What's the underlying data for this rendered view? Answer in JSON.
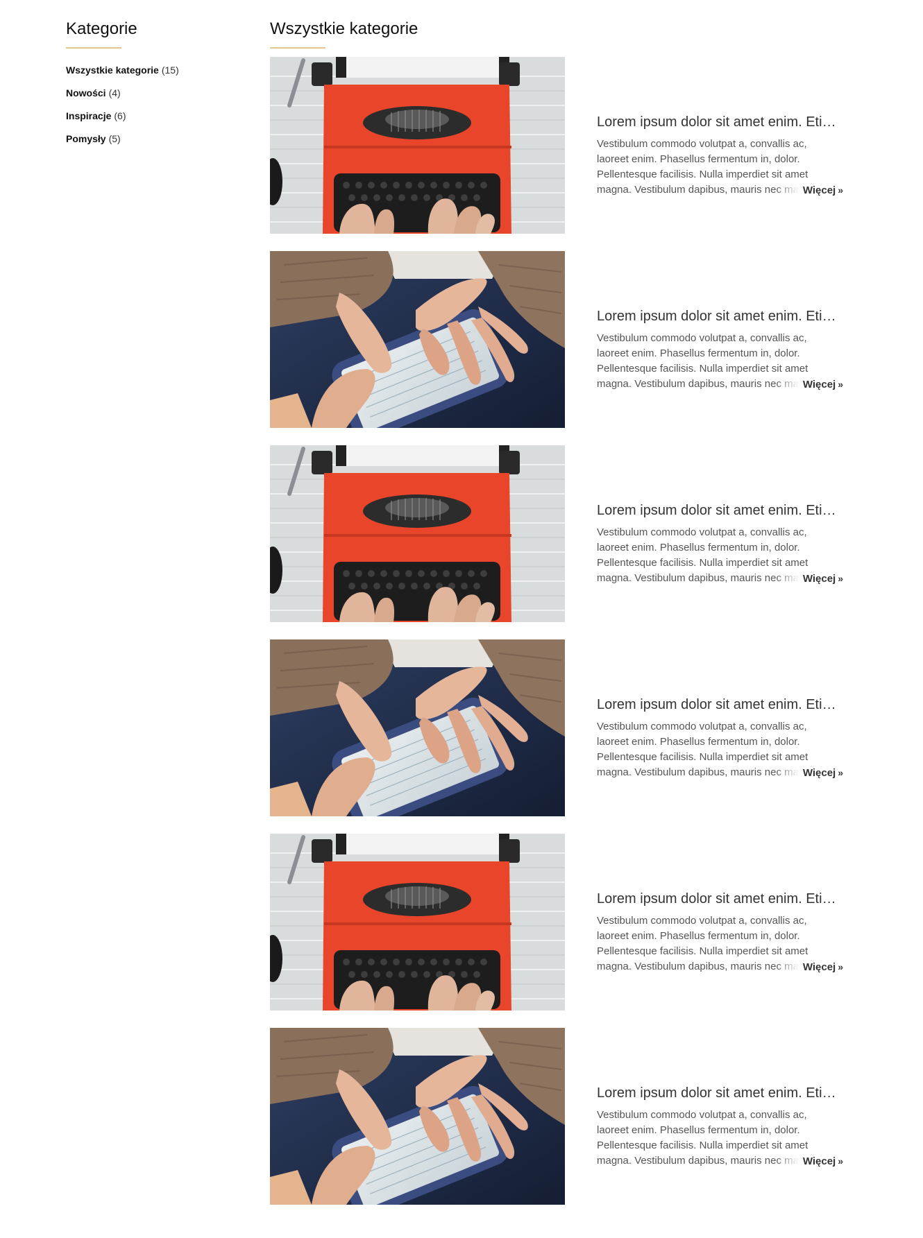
{
  "sidebar": {
    "title": "Kategorie",
    "categories": [
      {
        "name": "Wszystkie kategorie",
        "count": "(15)"
      },
      {
        "name": "Nowości",
        "count": "(4)"
      },
      {
        "name": "Inspiracje",
        "count": "(6)"
      },
      {
        "name": "Pomysły",
        "count": "(5)"
      }
    ]
  },
  "main": {
    "title": "Wszystkie kategorie",
    "more_label": "Więcej",
    "more_arrow": "»",
    "posts": [
      {
        "image": "typewriter",
        "title": "Lorem ipsum dolor sit amet enim. Etiam ullamcorper.",
        "excerpt": "Vestibulum commodo volutpat a, convallis ac, laoreet enim. Phasellus fermentum in, dolor. Pellentesque facilisis. Nulla imperdiet sit amet magna. Vestibulum dapibus, mauris nec malesuada fames ac turpis"
      },
      {
        "image": "smartphone",
        "title": "Lorem ipsum dolor sit amet enim. Etiam ullamcorper.",
        "excerpt": "Vestibulum commodo volutpat a, convallis ac, laoreet enim. Phasellus fermentum in, dolor. Pellentesque facilisis. Nulla imperdiet sit amet magna. Vestibulum dapibus, mauris nec malesuada fames ac turpis"
      },
      {
        "image": "typewriter",
        "title": "Lorem ipsum dolor sit amet enim. Etiam ullamcorper.",
        "excerpt": "Vestibulum commodo volutpat a, convallis ac, laoreet enim. Phasellus fermentum in, dolor. Pellentesque facilisis. Nulla imperdiet sit amet magna. Vestibulum dapibus, mauris nec malesuada fames ac turpis"
      },
      {
        "image": "smartphone",
        "title": "Lorem ipsum dolor sit amet enim. Etiam ullamcorper.",
        "excerpt": "Vestibulum commodo volutpat a, convallis ac, laoreet enim. Phasellus fermentum in, dolor. Pellentesque facilisis. Nulla imperdiet sit amet magna. Vestibulum dapibus, mauris nec malesuada fames ac turpis"
      },
      {
        "image": "typewriter",
        "title": "Lorem ipsum dolor sit amet enim. Etiam ullamcorper.",
        "excerpt": "Vestibulum commodo volutpat a, convallis ac, laoreet enim. Phasellus fermentum in, dolor. Pellentesque facilisis. Nulla imperdiet sit amet magna. Vestibulum dapibus, mauris nec malesuada fames ac turpis"
      },
      {
        "image": "smartphone",
        "title": "Lorem ipsum dolor sit amet enim. Etiam ullamcorper.",
        "excerpt": "Vestibulum commodo volutpat a, convallis ac, laoreet enim. Phasellus fermentum in, dolor. Pellentesque facilisis. Nulla imperdiet sit amet magna. Vestibulum dapibus, mauris nec malesuada fames ac turpis"
      }
    ]
  },
  "colors": {
    "accent_underline": "#e3c48a",
    "typewriter_red": "#e8452a",
    "wood": "#d9dcdd",
    "jeans": "#1f2d4a"
  }
}
